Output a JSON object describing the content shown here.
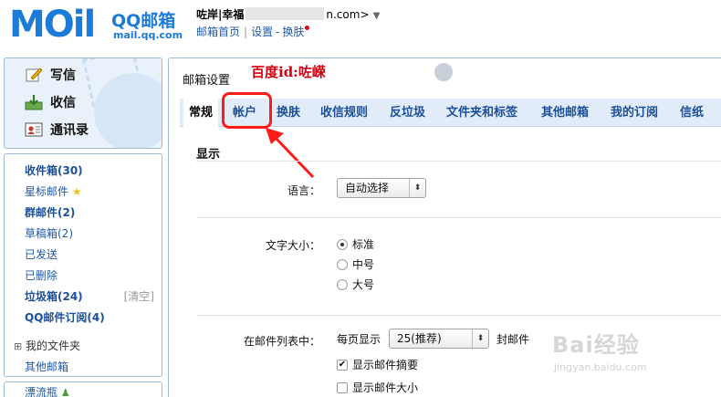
{
  "brand": {
    "logo": "MOil",
    "name": "QQ邮箱",
    "url": "mail.qq.com"
  },
  "user": {
    "name": "咗岸|幸福",
    "domain_suffix": "n.com>",
    "caret": "▼"
  },
  "header_links": {
    "home": "邮箱首页",
    "separator": "|",
    "settings": "设置",
    "dash": "-",
    "skin": "换肤"
  },
  "sidebar": {
    "top": [
      {
        "label": "写信",
        "icon": "compose-icon"
      },
      {
        "label": "收信",
        "icon": "inbox-download-icon"
      },
      {
        "label": "通讯录",
        "icon": "contacts-icon"
      }
    ],
    "folders": [
      {
        "label": "收件箱(30)",
        "bold": true
      },
      {
        "label": "星标邮件",
        "bold": false,
        "icon": "star-icon"
      },
      {
        "label": "群邮件(2)",
        "bold": true
      },
      {
        "label": "草稿箱(2)",
        "bold": false
      },
      {
        "label": "已发送",
        "bold": false
      },
      {
        "label": "已删除",
        "bold": false
      },
      {
        "label": "垃圾箱(24)",
        "bold": true
      },
      {
        "label": "QQ邮件订阅(4)",
        "bold": true
      },
      {
        "label": "我的文件夹",
        "bold": false,
        "expand": "⊞"
      },
      {
        "label": "其他邮箱",
        "bold": false
      },
      {
        "label": "漂流瓶",
        "bold": false
      }
    ],
    "clean_label": "[清空]"
  },
  "main": {
    "title": "邮箱设置",
    "note": "百度id:咗嵘",
    "tabs": [
      "常规",
      "帐户",
      "换肤",
      "收信规则",
      "反垃圾",
      "文件夹和标签",
      "其他邮箱",
      "我的订阅",
      "信纸"
    ],
    "active_tab": "常规",
    "highlighted_tab": "帐户",
    "section": "显示",
    "language": {
      "label": "语言：",
      "value": "自动选择"
    },
    "font_size": {
      "label": "文字大小：",
      "options": [
        "标准",
        "中号",
        "大号"
      ],
      "selected": "标准"
    },
    "list": {
      "label": "在邮件列表中：",
      "per_page_prefix": "每页显示",
      "per_page_value": "25(推荐)",
      "per_page_suffix": "封邮件",
      "show_summary": {
        "label": "显示邮件摘要",
        "checked": true
      },
      "show_size": {
        "label": "显示邮件大小",
        "checked": false
      }
    }
  },
  "watermark": {
    "text": "Bai经验",
    "url": "jingyan.baidu.com"
  },
  "colors": {
    "brand_blue": "#1c7ad8",
    "link_blue": "#1f58a8",
    "annotation_red": "#ff1a1a"
  }
}
